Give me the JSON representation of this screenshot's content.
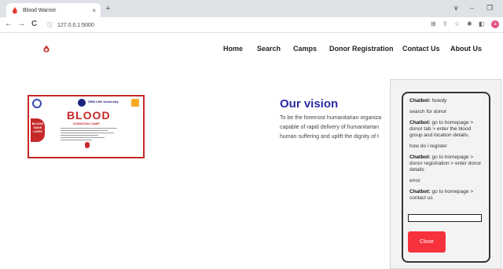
{
  "browser": {
    "tab_title": "Blood Warrior",
    "tab_close": "×",
    "new_tab": "+",
    "url": "127.0.0.1:5000",
    "back": "←",
    "forward": "→",
    "reload": "C",
    "info": "ⓘ",
    "minimize": "–",
    "restore": "❐",
    "chevron": "∨",
    "profile_initial": "a"
  },
  "nav": {
    "items": [
      "Home",
      "Search",
      "Camps",
      "Donor Registration",
      "Contact Us",
      "About Us"
    ]
  },
  "poster": {
    "title": "BLOOD",
    "subtitle": "DONATION CAMP",
    "side_text": "BLOOD SAVE LIVES",
    "university": "SRM LNK University"
  },
  "vision": {
    "title": "Our vision",
    "lines": [
      "To be the foremost humanitarian organiza",
      "capable of rapid delivery of humanitarian",
      "human suffering and uplift the dignity of t"
    ]
  },
  "chatbot": {
    "messages": [
      {
        "from": "Chatbot:",
        "text": " howdy"
      },
      {
        "from": "",
        "text": "search for donor"
      },
      {
        "from": "Chatbot:",
        "text": " go to homepage > donor tab > enter the blood group and location details."
      },
      {
        "from": "",
        "text": "how do i register"
      },
      {
        "from": "Chatbot:",
        "text": " go to homepage > donor registration > enter donor details"
      },
      {
        "from": "",
        "text": "error"
      },
      {
        "from": "Chatbot:",
        "text": " go to homepage > contact us"
      }
    ],
    "input_value": "",
    "close_label": "Close"
  },
  "colors": {
    "accent": "#2b2ba6",
    "brand_red": "#c62828",
    "close_button": "#f7323d"
  }
}
